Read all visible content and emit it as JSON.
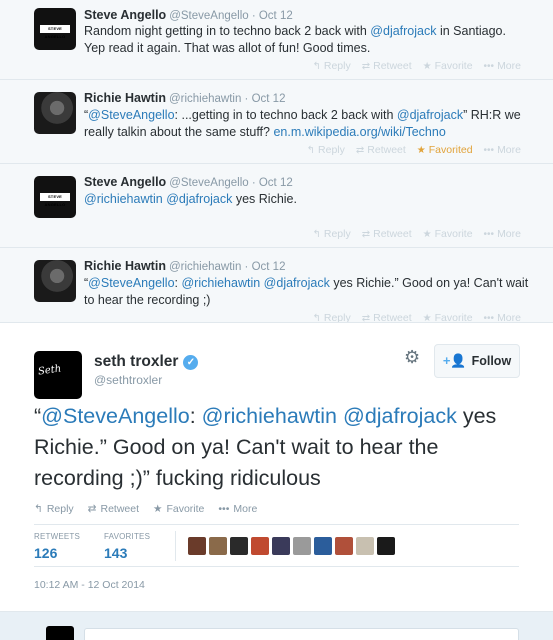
{
  "thread": [
    {
      "name": "Steve Angello",
      "meta": "@SteveAngello · Oct 12",
      "avatar_label": "STEVE ANGELLO",
      "text": [
        {
          "t": "Random night getting in to techno back 2 back with ",
          "link": false
        },
        {
          "t": "@djafrojack",
          "link": true
        },
        {
          "t": " in Santiago. Yep read it again. That was allot of fun! Good times.",
          "link": false
        }
      ],
      "favorited": false
    },
    {
      "name": "Richie Hawtin",
      "meta": "@richiehawtin · Oct 12",
      "text": [
        {
          "t": "“",
          "link": false
        },
        {
          "t": "@SteveAngello",
          "link": true
        },
        {
          "t": ": ...getting in to techno back 2 back with ",
          "link": false
        },
        {
          "t": "@djafrojack",
          "link": true
        },
        {
          "t": "” RH:R we really talkin about the same stuff? ",
          "link": false
        },
        {
          "t": "en.m.wikipedia.org/wiki/Techno",
          "link": true
        }
      ],
      "favorited": true
    },
    {
      "name": "Steve Angello",
      "meta": "@SteveAngello · Oct 12",
      "avatar_label": "STEVE ANGELLO",
      "text": [
        {
          "t": "@richiehawtin",
          "link": true
        },
        {
          "t": " ",
          "link": false
        },
        {
          "t": "@djafrojack",
          "link": true
        },
        {
          "t": " yes Richie.",
          "link": false
        }
      ],
      "favorited": false
    },
    {
      "name": "Richie Hawtin",
      "meta": "@richiehawtin · Oct 12",
      "text": [
        {
          "t": "“",
          "link": false
        },
        {
          "t": "@SteveAngello",
          "link": true
        },
        {
          "t": ": ",
          "link": false
        },
        {
          "t": "@richiehawtin",
          "link": true
        },
        {
          "t": " ",
          "link": false
        },
        {
          "t": "@djafrojack",
          "link": true
        },
        {
          "t": " yes Richie.”  Good on ya! Can't wait to hear the recording ;)",
          "link": false
        }
      ],
      "favorited": false
    }
  ],
  "action_labels": {
    "reply": "Reply",
    "retweet": "Retweet",
    "favorite": "Favorite",
    "favorited": "Favorited",
    "more": "More"
  },
  "main": {
    "name": "seth troxler",
    "handle": "@sethtroxler",
    "follow_label": "Follow",
    "text": [
      {
        "t": "“",
        "link": false
      },
      {
        "t": "@SteveAngello",
        "link": true
      },
      {
        "t": ": ",
        "link": false
      },
      {
        "t": "@richiehawtin",
        "link": true
      },
      {
        "t": " ",
        "link": false
      },
      {
        "t": "@djafrojack",
        "link": true
      },
      {
        "t": " yes Richie.”  Good on ya! Can't wait to hear the recording ;)” fucking ridiculous",
        "link": false
      }
    ],
    "stats": {
      "retweets_label": "RETWEETS",
      "retweets": "126",
      "favorites_label": "FAVORITES",
      "favorites": "143"
    },
    "timestamp": "10:12 AM - 12 Oct 2014",
    "favoriter_colors": [
      "#6a3b2a",
      "#8a6a4a",
      "#2a2a2a",
      "#c04a30",
      "#3a3a5a",
      "#9a9a9a",
      "#2b5d9b",
      "#b0503a",
      "#c8c0b0",
      "#1a1a1a"
    ]
  },
  "colors": {
    "link": "#2b7bb9",
    "favorited": "#e1a33b",
    "verified": "#55acee"
  }
}
